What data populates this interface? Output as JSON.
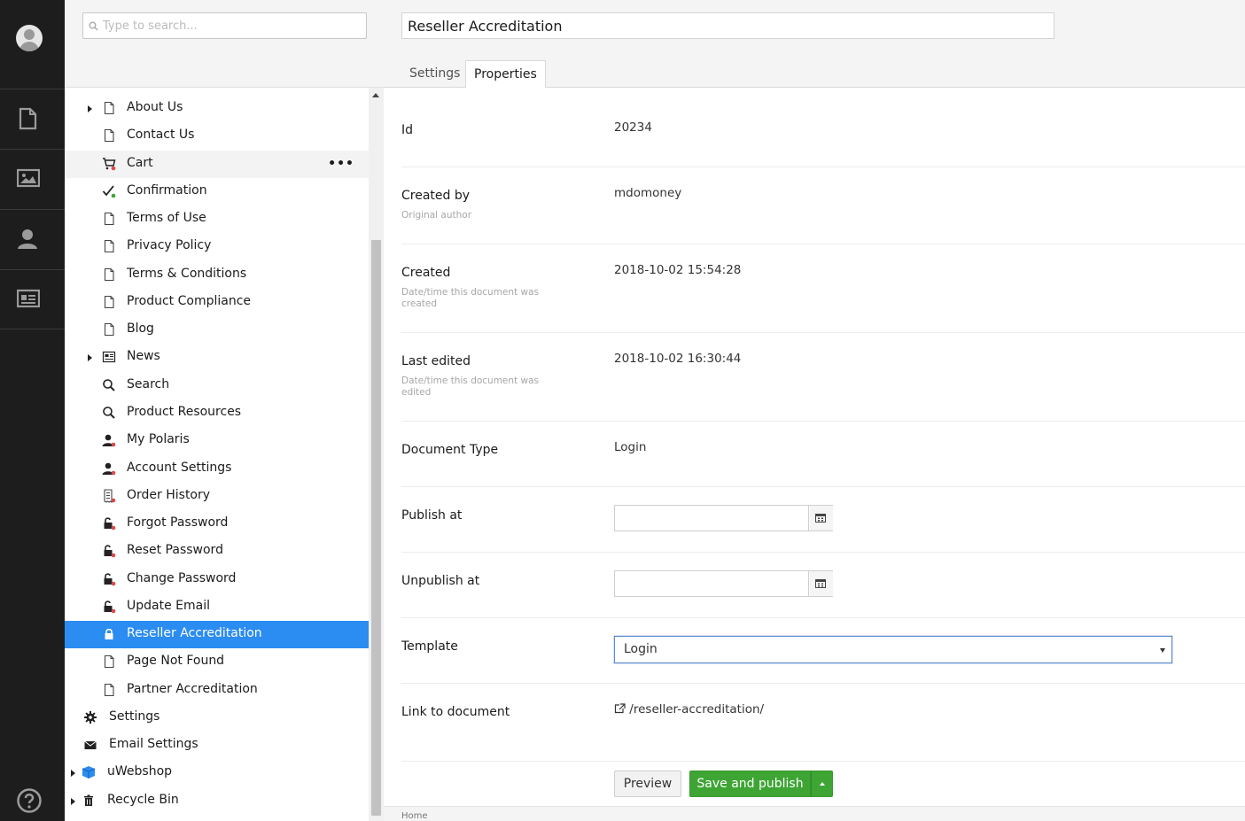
{
  "app_bar": {
    "sections": [
      "content-icon",
      "media-icon",
      "members-icon",
      "forms-icon"
    ],
    "help_icon": "help-icon"
  },
  "tree": {
    "search_placeholder": "Type to search...",
    "items": [
      {
        "label": "About Us",
        "icon": "page-icon",
        "caret": true
      },
      {
        "label": "Contact Us",
        "icon": "page-icon"
      },
      {
        "label": "Cart",
        "icon": "cart-icon",
        "hover": true
      },
      {
        "label": "Confirmation",
        "icon": "check-icon"
      },
      {
        "label": "Terms of Use",
        "icon": "page-icon"
      },
      {
        "label": "Privacy Policy",
        "icon": "page-icon"
      },
      {
        "label": "Terms & Conditions",
        "icon": "page-icon"
      },
      {
        "label": "Product Compliance",
        "icon": "page-icon"
      },
      {
        "label": "Blog",
        "icon": "page-icon"
      },
      {
        "label": "News",
        "icon": "news-icon",
        "caret": true
      },
      {
        "label": "Search",
        "icon": "search-icon"
      },
      {
        "label": "Product Resources",
        "icon": "search-icon"
      },
      {
        "label": "My Polaris",
        "icon": "member-icon"
      },
      {
        "label": "Account Settings",
        "icon": "member-icon"
      },
      {
        "label": "Order History",
        "icon": "receipt-icon"
      },
      {
        "label": "Forgot Password",
        "icon": "unlock-icon"
      },
      {
        "label": "Reset Password",
        "icon": "unlock-icon"
      },
      {
        "label": "Change Password",
        "icon": "unlock-icon"
      },
      {
        "label": "Update Email",
        "icon": "unlock-icon"
      },
      {
        "label": "Reseller Accreditation",
        "icon": "lock-icon",
        "selected": true
      },
      {
        "label": "Page Not Found",
        "icon": "page-icon"
      },
      {
        "label": "Partner Accreditation",
        "icon": "page-icon"
      },
      {
        "label": "Settings",
        "icon": "gear-icon",
        "level": 0
      },
      {
        "label": "Email Settings",
        "icon": "envelope-icon",
        "level": 0
      },
      {
        "label": "uWebshop",
        "icon": "cube-icon",
        "level": -1,
        "caret": true
      },
      {
        "label": "Recycle Bin",
        "icon": "trash-icon",
        "level": -1,
        "caret": true
      }
    ],
    "more_label": "•••"
  },
  "editor": {
    "doc_name": "Reseller Accreditation",
    "tabs": [
      {
        "label": "Settings"
      },
      {
        "label": "Properties",
        "active": true
      }
    ],
    "props": {
      "id": {
        "name": "Id",
        "value": "20234"
      },
      "created_by": {
        "name": "Created by",
        "desc": "Original author",
        "value": "mdomoney"
      },
      "created": {
        "name": "Created",
        "desc": "Date/time this document was created",
        "value": "2018-10-02 15:54:28"
      },
      "last_edited": {
        "name": "Last edited",
        "desc": "Date/time this document was edited",
        "value": "2018-10-02 16:30:44"
      },
      "doc_type": {
        "name": "Document Type",
        "value": "Login"
      },
      "publish_at": {
        "name": "Publish at",
        "value": ""
      },
      "unpublish_at": {
        "name": "Unpublish at",
        "value": ""
      },
      "template": {
        "name": "Template",
        "value": "Login"
      },
      "link": {
        "name": "Link to document",
        "value": "/reseller-accreditation/"
      }
    },
    "buttons": {
      "preview": "Preview",
      "save_publish": "Save and publish"
    },
    "breadcrumb": "Home"
  },
  "colors": {
    "selected": "#2b8cf1",
    "publish": "#3ea535",
    "appbar": "#1d1d1d"
  }
}
